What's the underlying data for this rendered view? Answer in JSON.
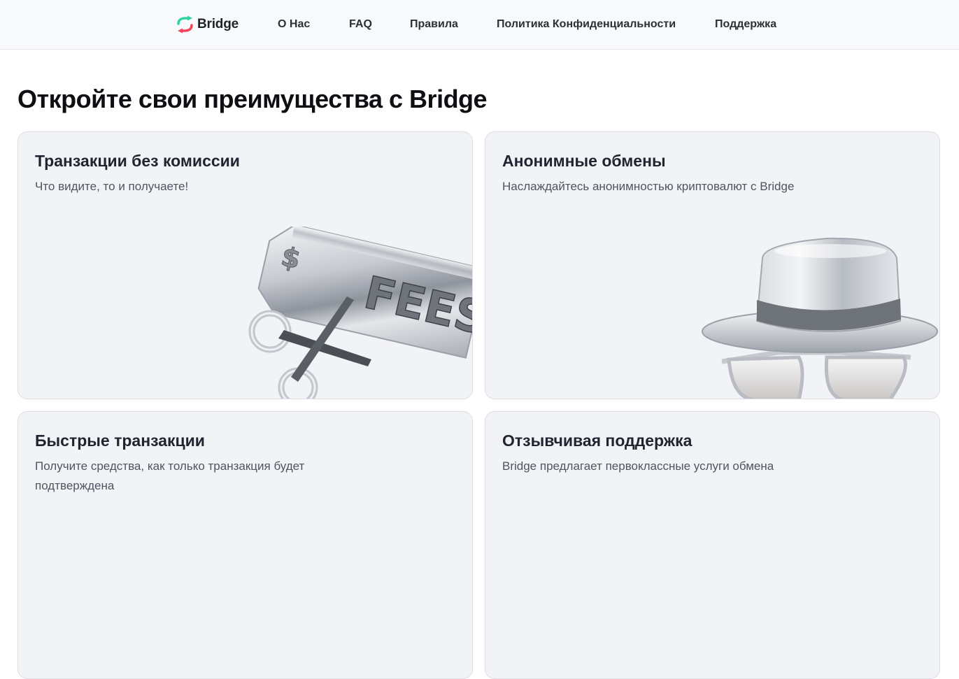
{
  "header": {
    "brand": "Bridge",
    "nav": [
      {
        "label": "О Нас"
      },
      {
        "label": "FAQ"
      },
      {
        "label": "Правила"
      },
      {
        "label": "Политика Конфиденциальности"
      },
      {
        "label": "Поддержка"
      }
    ]
  },
  "main": {
    "title": "Откройте свои преимущества с Bridge",
    "cards": [
      {
        "title": "Транзакции без комиссии",
        "description": "Что видите, то и получаете!",
        "image_text": "FEES",
        "image_icon": "dollar-sign-icon"
      },
      {
        "title": "Анонимные обмены",
        "description": "Наслаждайтесь анонимностью криптовалют с Bridge",
        "image_icon": "hat-glasses-icon"
      },
      {
        "title": "Быстрые транзакции",
        "description": "Получите средства, как только транзакция будет подтверждена"
      },
      {
        "title": "Отзывчивая поддержка",
        "description": "Bridge предлагает первоклассные услуги обмена"
      }
    ]
  },
  "colors": {
    "logo_green": "#2fd3a3",
    "logo_red": "#f0455a",
    "card_bg": "#f2f3f6",
    "nav_bg": "#f8f9fa"
  }
}
